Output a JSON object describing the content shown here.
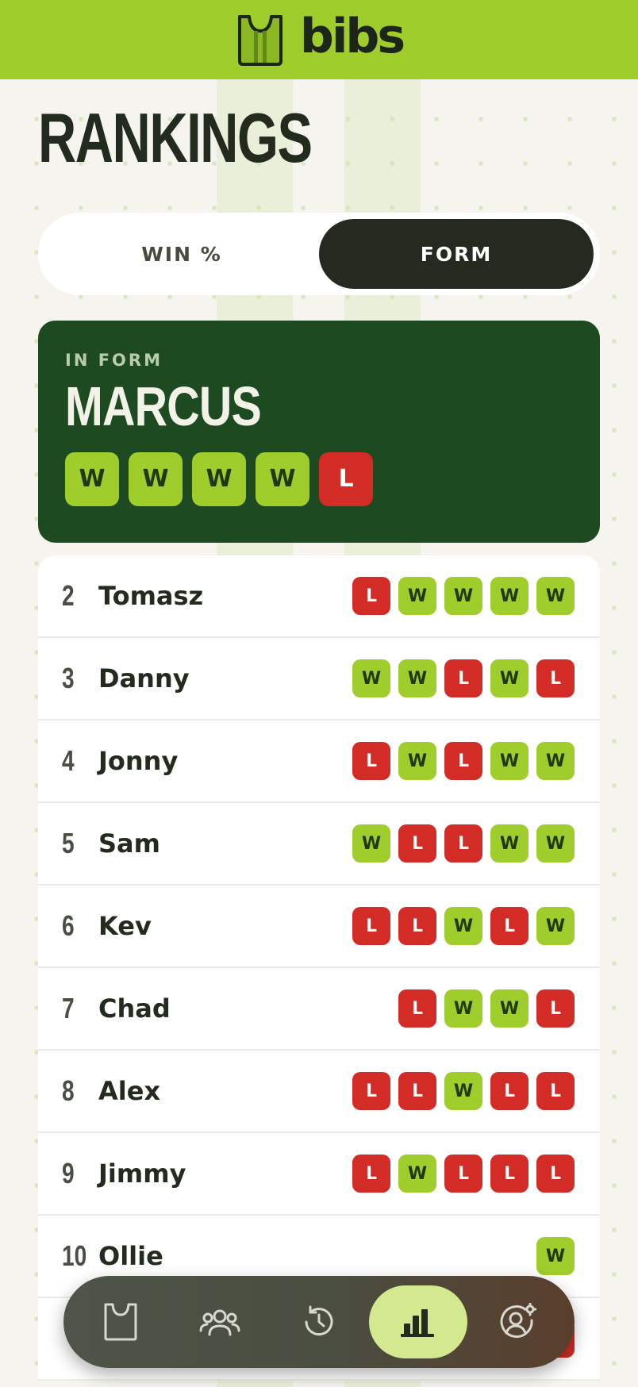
{
  "app": {
    "brand": "bibs"
  },
  "page": {
    "title": "RANKINGS"
  },
  "tabs": [
    {
      "label": "WIN %",
      "active": false
    },
    {
      "label": "FORM",
      "active": true
    }
  ],
  "featured": {
    "label": "IN FORM",
    "name": "MARCUS",
    "form": [
      "W",
      "W",
      "W",
      "W",
      "L"
    ]
  },
  "rankings": [
    {
      "rank": "2",
      "name": "Tomasz",
      "form": [
        "L",
        "W",
        "W",
        "W",
        "W"
      ]
    },
    {
      "rank": "3",
      "name": "Danny",
      "form": [
        "W",
        "W",
        "L",
        "W",
        "L"
      ]
    },
    {
      "rank": "4",
      "name": "Jonny",
      "form": [
        "L",
        "W",
        "L",
        "W",
        "W"
      ]
    },
    {
      "rank": "5",
      "name": "Sam",
      "form": [
        "W",
        "L",
        "L",
        "W",
        "W"
      ]
    },
    {
      "rank": "6",
      "name": "Kev",
      "form": [
        "L",
        "L",
        "W",
        "L",
        "W"
      ]
    },
    {
      "rank": "7",
      "name": "Chad",
      "form": [
        "L",
        "W",
        "W",
        "L"
      ]
    },
    {
      "rank": "8",
      "name": "Alex",
      "form": [
        "L",
        "L",
        "W",
        "L",
        "L"
      ]
    },
    {
      "rank": "9",
      "name": "Jimmy",
      "form": [
        "L",
        "W",
        "L",
        "L",
        "L"
      ]
    },
    {
      "rank": "10",
      "name": "Ollie",
      "form": [
        "W"
      ]
    },
    {
      "rank": "",
      "name": "",
      "form": [
        "L"
      ]
    }
  ],
  "nav": [
    {
      "icon": "bib-icon",
      "active": false
    },
    {
      "icon": "players-icon",
      "active": false
    },
    {
      "icon": "history-icon",
      "active": false
    },
    {
      "icon": "rankings-icon",
      "active": true
    },
    {
      "icon": "profile-settings-icon",
      "active": false
    }
  ],
  "colors": {
    "brand": "#9fcd2c",
    "win": "#9fcd2c",
    "loss": "#d32c26",
    "featured_card": "#1e4a22",
    "dark": "#242a1f"
  }
}
